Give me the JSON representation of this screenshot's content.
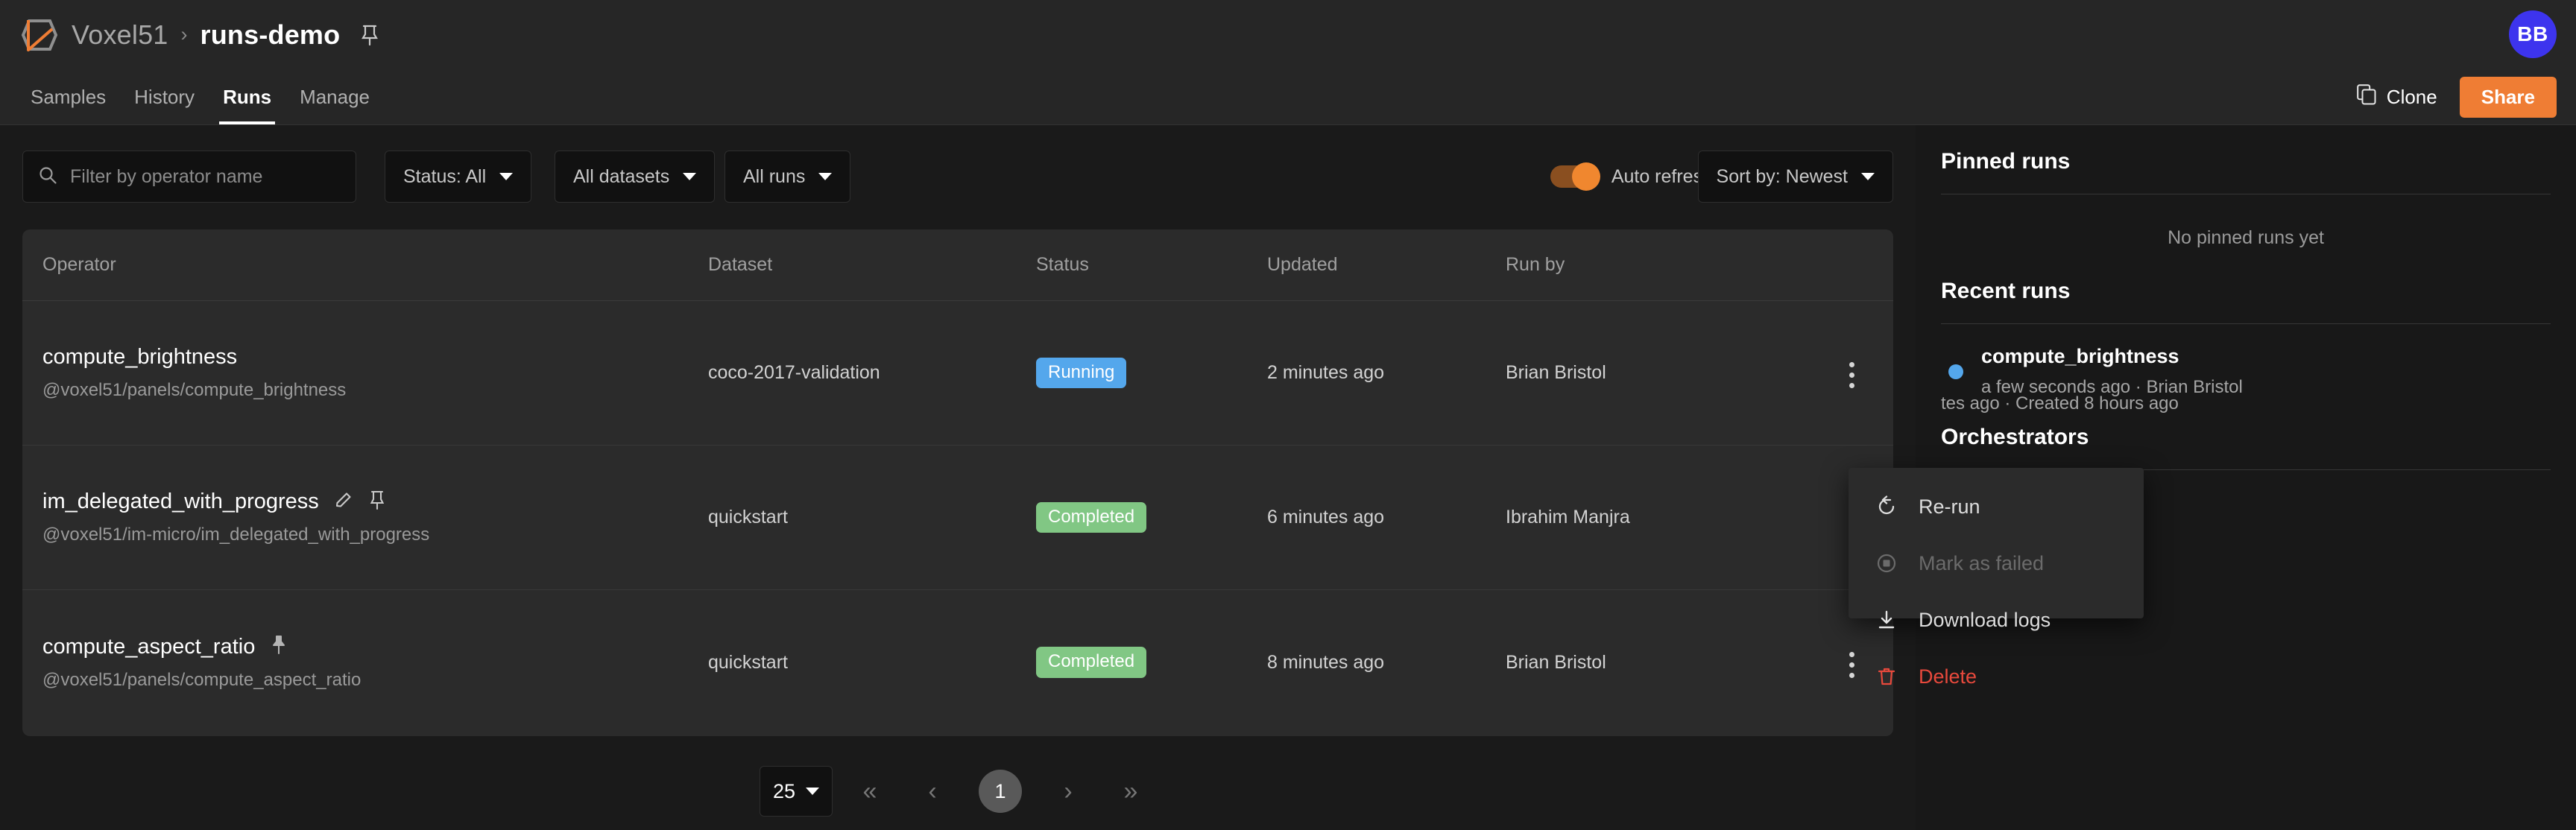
{
  "header": {
    "logo_icon": "voxel51-logo-icon",
    "org": "Voxel51",
    "separator": "›",
    "project": "runs-demo",
    "pin_icon": "pin-icon",
    "avatar_initials": "BB",
    "avatar_color": "#3d34ee"
  },
  "tabs": [
    {
      "label": "Samples",
      "active": false
    },
    {
      "label": "History",
      "active": false
    },
    {
      "label": "Runs",
      "active": true
    },
    {
      "label": "Manage",
      "active": false
    }
  ],
  "actions": {
    "clone_label": "Clone",
    "clone_icon": "copy-icon",
    "share_label": "Share",
    "share_color": "#ef7d34"
  },
  "toolbar": {
    "search_placeholder": "Filter by operator name",
    "search_value": "",
    "search_icon": "search-icon",
    "filters": [
      {
        "label": "Status: All",
        "name": "status-filter"
      },
      {
        "label": "All datasets",
        "name": "datasets-filter"
      },
      {
        "label": "All runs",
        "name": "runs-filter"
      }
    ],
    "auto_refresh_label": "Auto refresh",
    "auto_refresh_on": true,
    "sort_label": "Sort by: Newest"
  },
  "table": {
    "columns": [
      "Operator",
      "Dataset",
      "Status",
      "Updated",
      "Run by"
    ],
    "rows": [
      {
        "operator": "compute_brightness",
        "path": "@voxel51/panels/compute_brightness",
        "dataset": "coco-2017-validation",
        "status": "Running",
        "status_kind": "running",
        "updated": "2 minutes ago",
        "run_by": "Brian Bristol",
        "has_edit": false,
        "has_pin": false
      },
      {
        "operator": "im_delegated_with_progress",
        "path": "@voxel51/im-micro/im_delegated_with_progress",
        "dataset": "quickstart",
        "status": "Completed",
        "status_kind": "completed",
        "updated": "6 minutes ago",
        "run_by": "Ibrahim Manjra",
        "has_edit": true,
        "has_pin": true
      },
      {
        "operator": "compute_aspect_ratio",
        "path": "@voxel51/panels/compute_aspect_ratio",
        "dataset": "quickstart",
        "status": "Completed",
        "status_kind": "completed",
        "updated": "8 minutes ago",
        "run_by": "Brian Bristol",
        "has_edit": false,
        "has_pin": true
      }
    ],
    "status_colors": {
      "running": "#54a7ec",
      "completed": "#81c784"
    }
  },
  "pagination": {
    "rows_per_page": "25",
    "first_label": "«",
    "prev_label": "‹",
    "current_page": "1",
    "next_label": "›",
    "last_label": "»"
  },
  "sidebar": {
    "pinned_title": "Pinned runs",
    "pinned_empty": "No pinned runs yet",
    "recent_title": "Recent runs",
    "recent": [
      {
        "name": "compute_brightness",
        "meta": "a few seconds ago  ·  Brian Bristol",
        "dot_color": "#54a7ec"
      }
    ],
    "orchestrators_title": "Orchestrators",
    "orchestrators_meta": "tes ago  ·  Created 8 hours ago"
  },
  "context_menu": {
    "items": [
      {
        "label": "Re-run",
        "icon": "rerun-icon",
        "state": "enabled"
      },
      {
        "label": "Mark as failed",
        "icon": "stop-icon",
        "state": "disabled"
      },
      {
        "label": "Download logs",
        "icon": "download-icon",
        "state": "enabled"
      },
      {
        "label": "Delete",
        "icon": "trash-icon",
        "state": "danger"
      }
    ]
  }
}
